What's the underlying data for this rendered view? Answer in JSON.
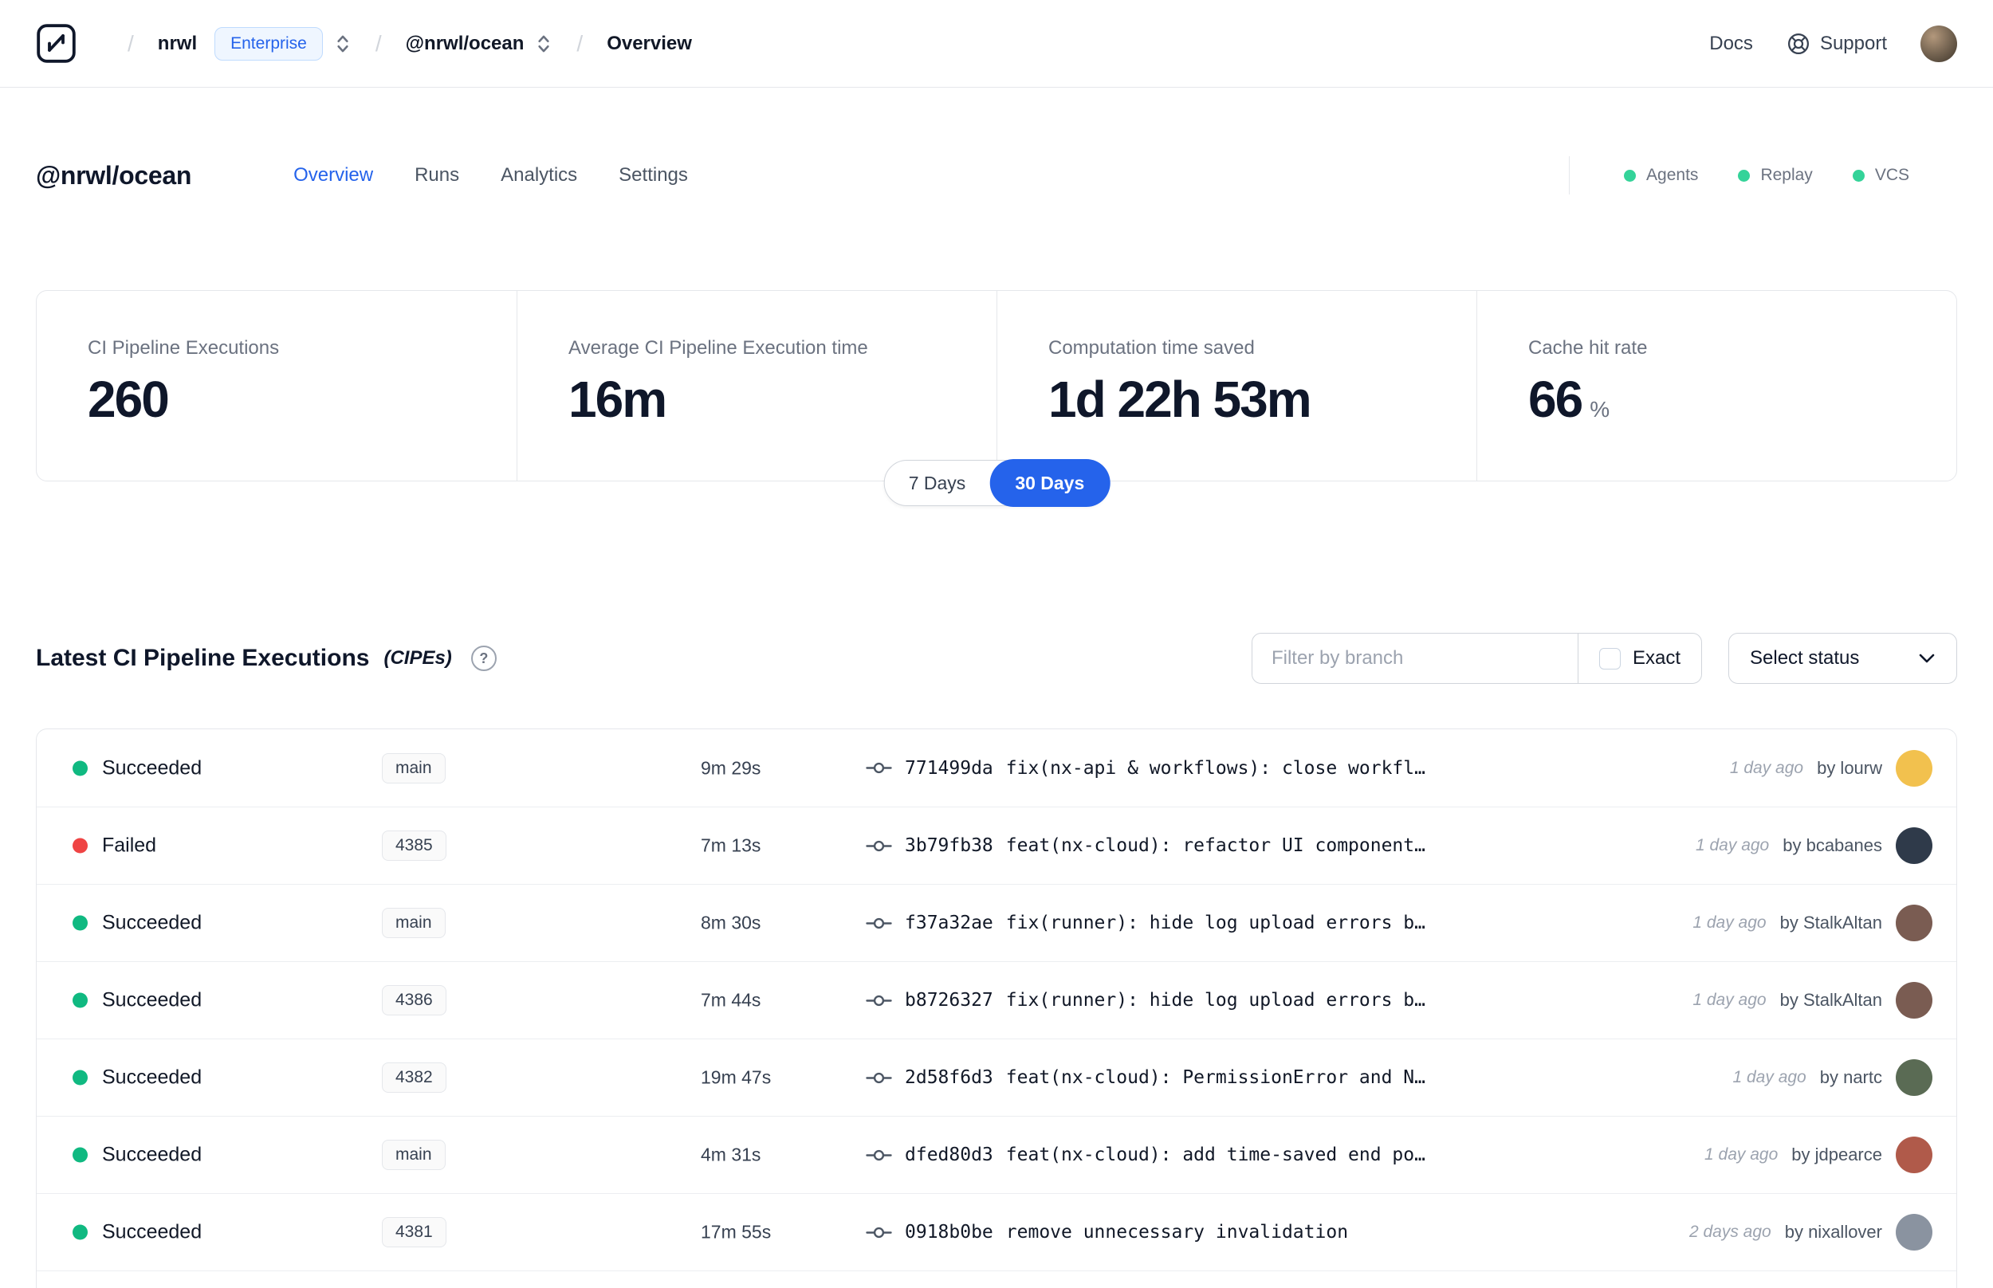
{
  "colors": {
    "accent": "#2563eb",
    "green": "#10b981",
    "red": "#ef4444"
  },
  "nav": {
    "org": "nrwl",
    "org_badge": "Enterprise",
    "workspace": "@nrwl/ocean",
    "page": "Overview",
    "docs": "Docs",
    "support": "Support"
  },
  "header": {
    "title": "@nrwl/ocean",
    "tabs": [
      {
        "label": "Overview",
        "active": true
      },
      {
        "label": "Runs",
        "active": false
      },
      {
        "label": "Analytics",
        "active": false
      },
      {
        "label": "Settings",
        "active": false
      }
    ],
    "integrations": [
      {
        "label": "Agents"
      },
      {
        "label": "Replay"
      },
      {
        "label": "VCS"
      }
    ]
  },
  "stats": {
    "cards": [
      {
        "label": "CI Pipeline Executions",
        "value": "260"
      },
      {
        "label": "Average CI Pipeline Execution time",
        "value": "16m"
      },
      {
        "label": "Computation time saved",
        "value": "1d 22h 53m"
      },
      {
        "label": "Cache hit rate",
        "value": "66",
        "unit": "%"
      }
    ],
    "range": {
      "options": [
        "7 Days",
        "30 Days"
      ],
      "selected": "30 Days"
    }
  },
  "cipes": {
    "title": "Latest CI Pipeline Executions",
    "title_suffix": "(CIPEs)",
    "filter_placeholder": "Filter by branch",
    "exact_label": "Exact",
    "status_select_label": "Select status",
    "rows": [
      {
        "status": "Succeeded",
        "status_color": "green",
        "branch": "main",
        "duration": "9m 29s",
        "commit_hash": "771499da",
        "commit_message": "fix(nx-api & workflows): close workfl…",
        "time": "1 day ago",
        "author": "by lourw",
        "avatar_color": "#f2c14e"
      },
      {
        "status": "Failed",
        "status_color": "red",
        "branch": "4385",
        "duration": "7m 13s",
        "commit_hash": "3b79fb38",
        "commit_message": "feat(nx-cloud): refactor UI component…",
        "time": "1 day ago",
        "author": "by bcabanes",
        "avatar_color": "#2f3a4a"
      },
      {
        "status": "Succeeded",
        "status_color": "green",
        "branch": "main",
        "duration": "8m 30s",
        "commit_hash": "f37a32ae",
        "commit_message": "fix(runner): hide log upload errors b…",
        "time": "1 day ago",
        "author": "by StalkAltan",
        "avatar_color": "#7a5c52"
      },
      {
        "status": "Succeeded",
        "status_color": "green",
        "branch": "4386",
        "duration": "7m 44s",
        "commit_hash": "b8726327",
        "commit_message": "fix(runner): hide log upload errors b…",
        "time": "1 day ago",
        "author": "by StalkAltan",
        "avatar_color": "#7a5c52"
      },
      {
        "status": "Succeeded",
        "status_color": "green",
        "branch": "4382",
        "duration": "19m 47s",
        "commit_hash": "2d58f6d3",
        "commit_message": "feat(nx-cloud): PermissionError and N…",
        "time": "1 day ago",
        "author": "by nartc",
        "avatar_color": "#5a6b54"
      },
      {
        "status": "Succeeded",
        "status_color": "green",
        "branch": "main",
        "duration": "4m 31s",
        "commit_hash": "dfed80d3",
        "commit_message": "feat(nx-cloud): add time-saved end po…",
        "time": "1 day ago",
        "author": "by jdpearce",
        "avatar_color": "#b05a4a"
      },
      {
        "status": "Succeeded",
        "status_color": "green",
        "branch": "4381",
        "duration": "17m 55s",
        "commit_hash": "0918b0be",
        "commit_message": "remove unnecessary invalidation",
        "time": "2 days ago",
        "author": "by nixallover",
        "avatar_color": "#8a93a0"
      }
    ]
  }
}
